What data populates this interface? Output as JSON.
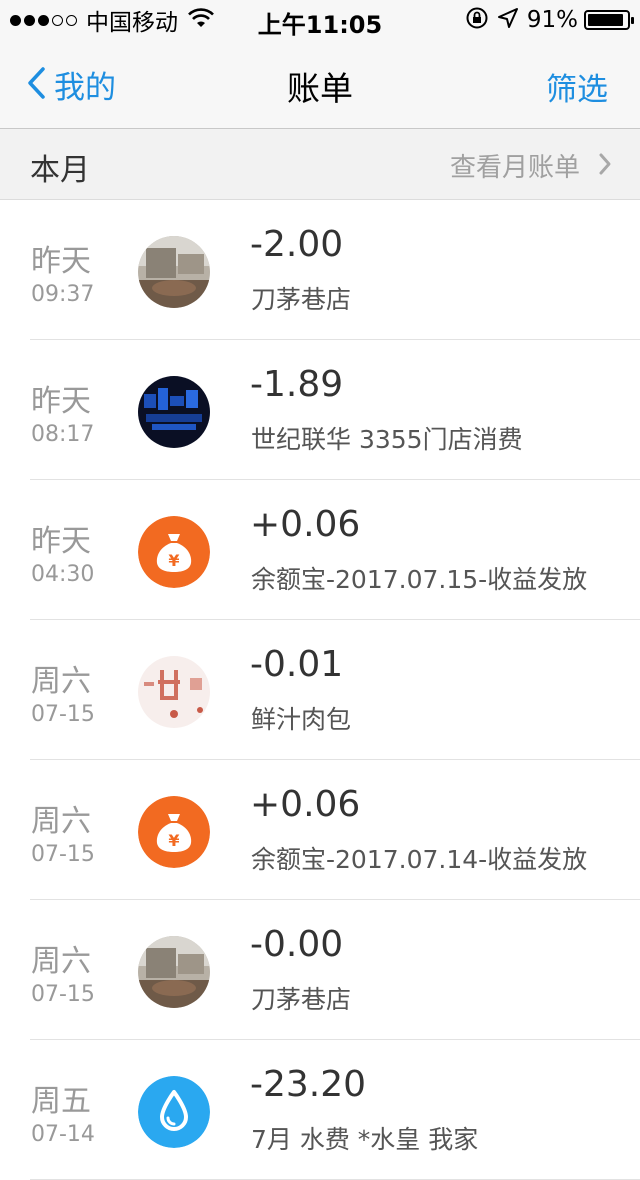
{
  "status_bar": {
    "carrier": "中国移动",
    "time": "上午11:05",
    "battery_pct": "91%",
    "battery_level": 0.91,
    "signal_filled": 3,
    "signal_total": 5
  },
  "nav": {
    "back_label": "我的",
    "title": "账单",
    "filter_label": "筛选"
  },
  "month": {
    "label": "本月",
    "view_label": "查看月账单"
  },
  "colors": {
    "accent": "#1e8ee0",
    "yuebao_orange": "#f26a21",
    "water_blue": "#2aa8f0"
  },
  "transactions": [
    {
      "day": "昨天",
      "time": "09:37",
      "amount": "-2.00",
      "desc": "刀茅巷店",
      "icon": "store-photo-avatar"
    },
    {
      "day": "昨天",
      "time": "08:17",
      "amount": "-1.89",
      "desc": "世纪联华 3355门店消费",
      "icon": "century-lianhua-logo-avatar"
    },
    {
      "day": "昨天",
      "time": "04:30",
      "amount": "+0.06",
      "desc": "余额宝-2017.07.15-收益发放",
      "icon": "yuebao-money-bag-icon"
    },
    {
      "day": "周六",
      "time": "07-15",
      "amount": "-0.01",
      "desc": "鲜汁肉包",
      "icon": "bun-shop-logo-avatar"
    },
    {
      "day": "周六",
      "time": "07-15",
      "amount": "+0.06",
      "desc": "余额宝-2017.07.14-收益发放",
      "icon": "yuebao-money-bag-icon"
    },
    {
      "day": "周六",
      "time": "07-15",
      "amount": "-0.00",
      "desc": "刀茅巷店",
      "icon": "store-photo-avatar"
    },
    {
      "day": "周五",
      "time": "07-14",
      "amount": "-23.20",
      "desc": "7月 水费 *水皇 我家",
      "icon": "water-drop-icon"
    }
  ]
}
